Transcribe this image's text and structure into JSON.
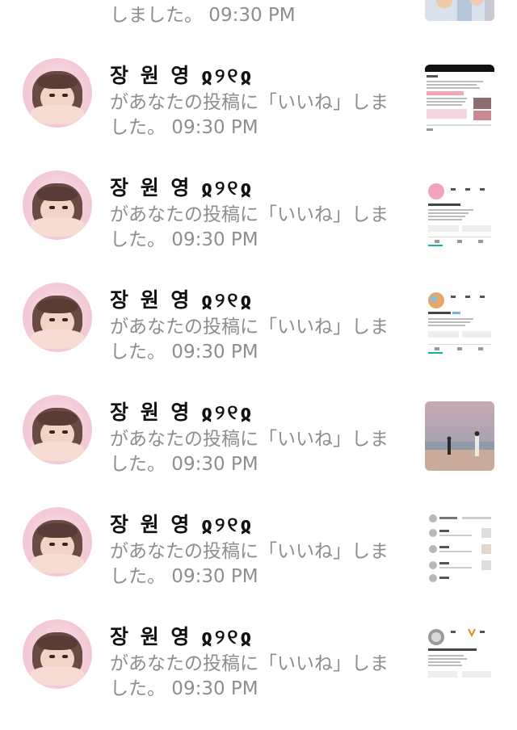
{
  "notifications": [
    {
      "name": "",
      "line1": "",
      "line2": "しました。 09:30 PM",
      "thumb": "photo-girls"
    },
    {
      "name": "장 원 영 ჲ୨୧ჲ",
      "line1": "があなたの投稿に「いいね」しま",
      "line2": "した。 09:30 PM",
      "thumb": "document-post"
    },
    {
      "name": "장 원 영 ჲ୨୧ჲ",
      "line1": "があなたの投稿に「いいね」しま",
      "line2": "した。 09:30 PM",
      "thumb": "profile-post"
    },
    {
      "name": "장 원 영 ჲ୨୧ჲ",
      "line1": "があなたの投稿に「いいね」しま",
      "line2": "した。 09:30 PM",
      "thumb": "profile-post-2"
    },
    {
      "name": "장 원 영 ჲ୨୧ჲ",
      "line1": "があなたの投稿に「いいね」しま",
      "line2": "した。 09:30 PM",
      "thumb": "beach-photo"
    },
    {
      "name": "장 원 영 ჲ୨୧ჲ",
      "line1": "があなたの投稿に「いいね」しま",
      "line2": "した。 09:30 PM",
      "thumb": "list-post"
    },
    {
      "name": "장 원 영 ჲ୨୧ჲ",
      "line1": "があなたの投稿に「いいね」しま",
      "line2": "した。 09:30 PM",
      "thumb": "profile-post-3"
    }
  ]
}
